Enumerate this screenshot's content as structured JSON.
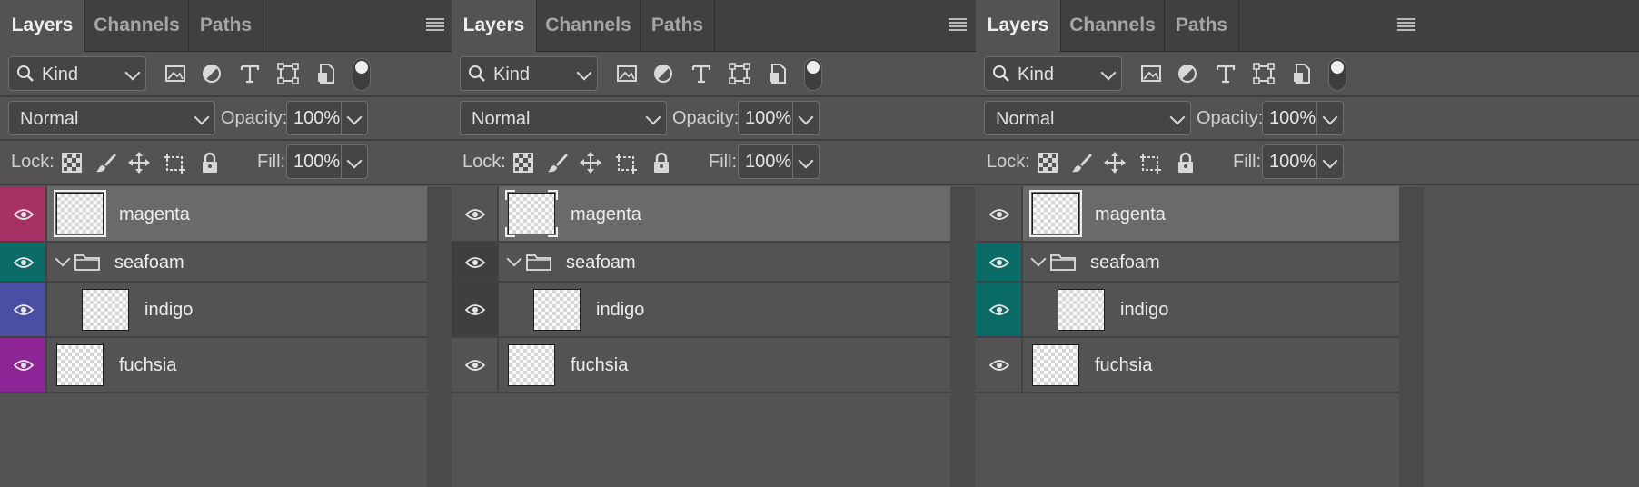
{
  "tabs": [
    "Layers",
    "Channels",
    "Paths"
  ],
  "filter": {
    "kind_label": "Kind"
  },
  "blend_mode": "Normal",
  "opacity": {
    "label": "Opacity:",
    "value": "100%"
  },
  "lock": {
    "label": "Lock:"
  },
  "fill": {
    "label": "Fill:",
    "value": "100%"
  },
  "layer_names": {
    "magenta": "magenta",
    "seafoam": "seafoam",
    "indigo": "indigo",
    "fuchsia": "fuchsia"
  },
  "colors": {
    "magenta": "#a53263",
    "seafoam": "#0b6c67",
    "indigo": "#4b4fa3",
    "fuchsia": "#8d2596",
    "none": "#535353",
    "dark": "#3f3f3f"
  },
  "panels": [
    {
      "eye_colors": [
        "magenta",
        "seafoam",
        "indigo",
        "fuchsia"
      ],
      "selection": "full"
    },
    {
      "eye_colors": [
        "none",
        "dark",
        "dark",
        "none"
      ],
      "selection": "corners"
    },
    {
      "eye_colors": [
        "none",
        "seafoam",
        "seafoam",
        "none"
      ],
      "selection": "full"
    }
  ]
}
